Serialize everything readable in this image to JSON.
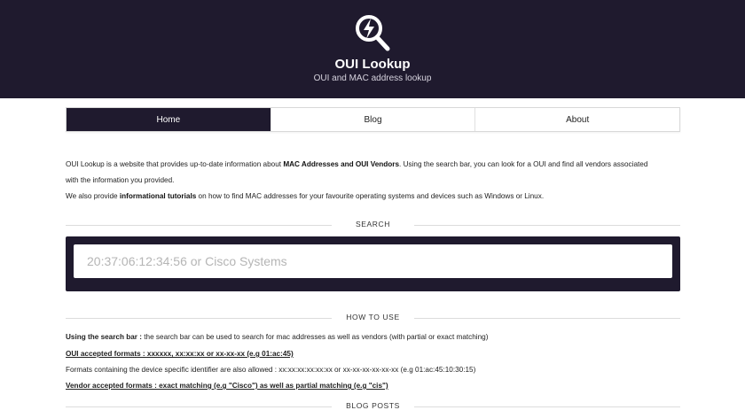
{
  "header": {
    "title": "OUI Lookup",
    "subtitle": "OUI and MAC address lookup",
    "logo_icon": "search-lightning-icon",
    "background": "#1f1a2e"
  },
  "nav": {
    "items": [
      {
        "label": "Home",
        "active": true
      },
      {
        "label": "Blog",
        "active": false
      },
      {
        "label": "About",
        "active": false
      }
    ]
  },
  "intro": {
    "p1_a": "OUI Lookup is a website that provides up-to-date information about ",
    "p1_b": "MAC Addresses and OUI Vendors",
    "p1_c": ". Using the search bar, you can look for a OUI and find all vendors associated",
    "p1_d": "with the information you provided.",
    "p2_a": "We also provide ",
    "p2_b": "informational tutorials",
    "p2_c": " on how to find MAC addresses for your favourite operating systems and devices such as Windows or Linux."
  },
  "search": {
    "heading": "SEARCH",
    "placeholder": "20:37:06:12:34:56 or Cisco Systems",
    "value": ""
  },
  "howto": {
    "heading": "HOW TO USE",
    "line1_bold": "Using the search bar :",
    "line1_rest": " the search bar can be used to search for mac addresses as well as vendors (with partial or exact matching)",
    "line2": "OUI accepted formats : xxxxxx, xx:xx:xx or xx-xx-xx (e.g 01:ac:45)",
    "line3": "Formats containing the device specific identifier are also allowed : xx:xx:xx:xx:xx:xx or xx-xx-xx-xx-xx-xx (e.g 01:ac:45:10:30:15)",
    "line4": "Vendor accepted formats : exact matching (e.g \"Cisco\") as well as partial matching (e.g \"cis\")"
  },
  "blog": {
    "heading": "BLOG POSTS"
  }
}
